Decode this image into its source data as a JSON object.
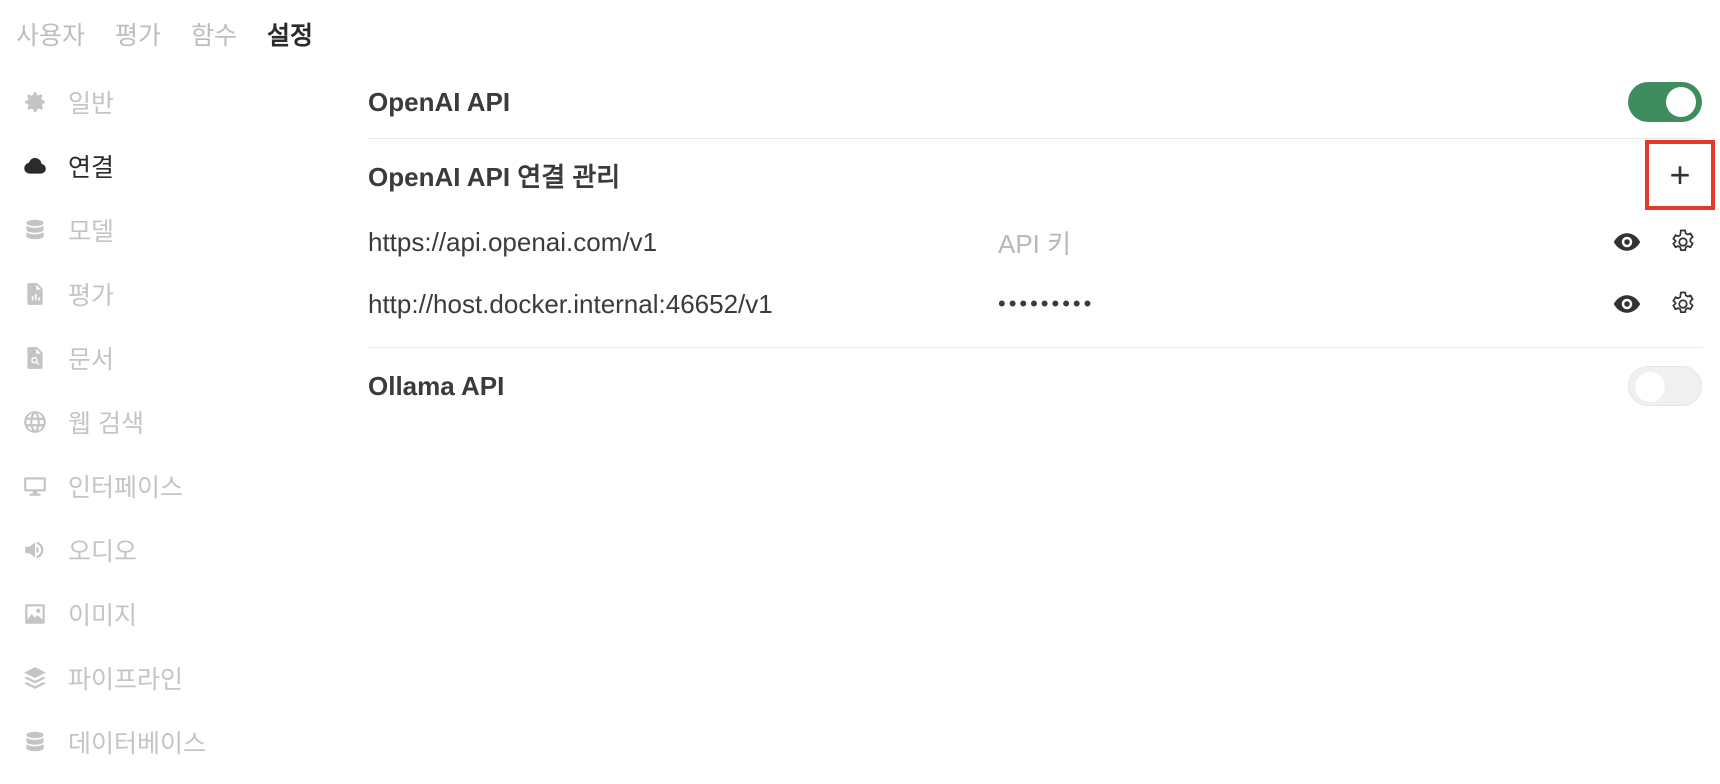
{
  "tabs": [
    "사용자",
    "평가",
    "함수",
    "설정"
  ],
  "active_tab": 3,
  "sidebar": {
    "items": [
      {
        "label": "일반",
        "icon": "gear-icon"
      },
      {
        "label": "연결",
        "icon": "cloud-icon"
      },
      {
        "label": "모델",
        "icon": "database-icon"
      },
      {
        "label": "평가",
        "icon": "document-chart-icon"
      },
      {
        "label": "문서",
        "icon": "document-search-icon"
      },
      {
        "label": "웹 검색",
        "icon": "globe-icon"
      },
      {
        "label": "인터페이스",
        "icon": "monitor-icon"
      },
      {
        "label": "오디오",
        "icon": "speaker-icon"
      },
      {
        "label": "이미지",
        "icon": "image-icon"
      },
      {
        "label": "파이프라인",
        "icon": "layers-icon"
      },
      {
        "label": "데이터베이스",
        "icon": "database-icon"
      }
    ],
    "active_index": 1
  },
  "openai": {
    "title": "OpenAI API",
    "enabled": true,
    "manage_title": "OpenAI API 연결 관리",
    "add_label": "+",
    "connections": [
      {
        "url": "https://api.openai.com/v1",
        "key_placeholder": "API 키",
        "key_value": ""
      },
      {
        "url": "http://host.docker.internal:46652/v1",
        "key_placeholder": "API 키",
        "key_value": "•••••••••"
      }
    ]
  },
  "ollama": {
    "title": "Ollama API",
    "enabled": false
  },
  "colors": {
    "toggle_on": "#3f8d5f",
    "highlight": "#e23a2a"
  }
}
